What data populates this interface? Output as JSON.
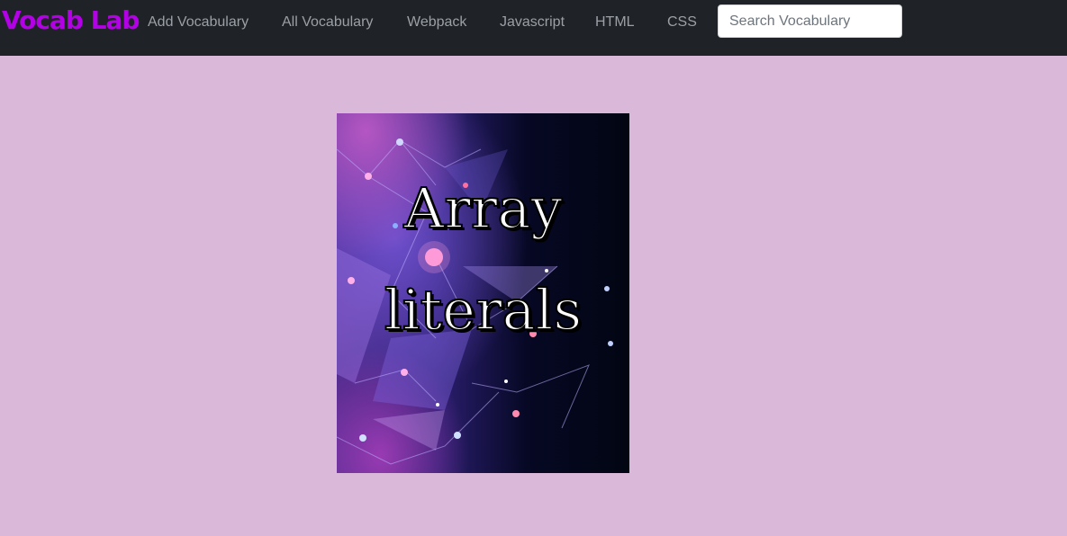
{
  "navbar": {
    "brand": "Vocab Lab",
    "links": [
      {
        "label": "Add Vocabulary"
      },
      {
        "label": "All Vocabulary"
      },
      {
        "label": "Webpack"
      },
      {
        "label": "Javascript"
      },
      {
        "label": "HTML"
      },
      {
        "label": "CSS"
      }
    ],
    "search_placeholder": "Search Vocabulary",
    "search_value": ""
  },
  "card": {
    "title_line1": "Array",
    "title_line2": "literals"
  },
  "colors": {
    "page_background": "#d9b8d9",
    "navbar_background": "#1f2226",
    "brand_color": "#b400e6",
    "nav_link_color": "#9aa0a6"
  }
}
